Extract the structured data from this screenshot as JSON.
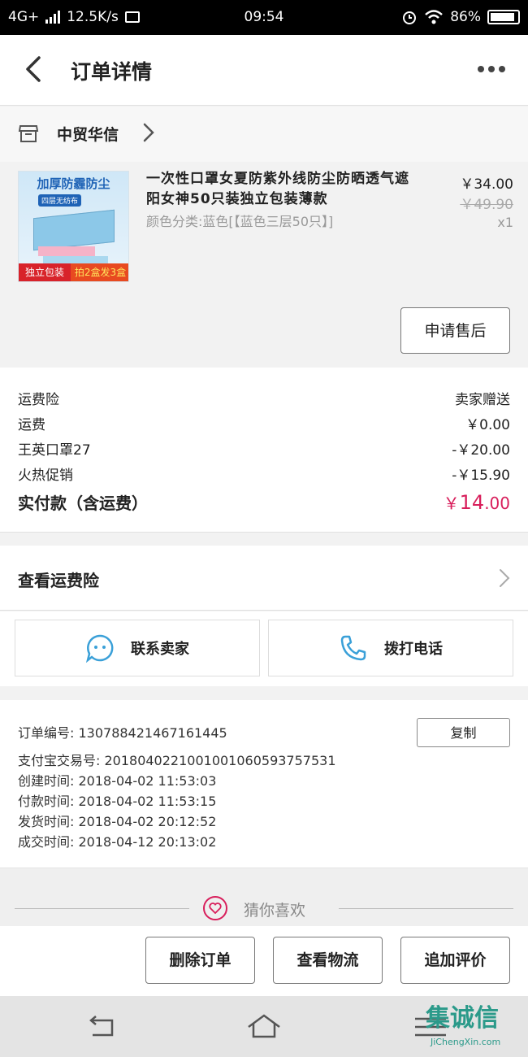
{
  "status_bar": {
    "network": "4G+",
    "speed": "12.5K/s",
    "time": "09:54",
    "battery": "86%"
  },
  "header": {
    "title": "订单详情"
  },
  "shop": {
    "name": "中贸华信"
  },
  "product": {
    "image_banner": "加厚防霾防尘",
    "image_sub": "四层无纺布",
    "image_tag_left": "独立包装",
    "image_tag_right": "拍2盒发3盒",
    "title": "一次性口罩女夏防紫外线防尘防晒透气遮阳女神50只装独立包装薄款",
    "spec": "颜色分类:蓝色[【蓝色三层50只】]",
    "price": "￥34.00",
    "original_price": "￥49.90",
    "quantity": "x1",
    "after_sale_label": "申请售后"
  },
  "fees": [
    {
      "label": "运费险",
      "value": "卖家赠送"
    },
    {
      "label": "运费",
      "value": "￥0.00"
    },
    {
      "label": "王英口罩27",
      "value": "-￥20.00"
    },
    {
      "label": "火热促销",
      "value": "-￥15.90"
    }
  ],
  "total": {
    "label": "实付款（含运费）",
    "currency": "￥",
    "integer": "14",
    "decimal": ".00"
  },
  "insurance": {
    "label": "查看运费险"
  },
  "contact": {
    "seller_label": "联系卖家",
    "phone_label": "拨打电话"
  },
  "order_info": {
    "copy_label": "复制",
    "rows": [
      "订单编号: 130788421467161445",
      "支付宝交易号: 2018040221001001060593757531",
      "创建时间: 2018-04-02 11:53:03",
      "付款时间: 2018-04-02 11:53:15",
      "发货时间: 2018-04-02 20:12:52",
      "成交时间: 2018-04-12 20:13:02"
    ]
  },
  "recommend": {
    "label": "猜你喜欢"
  },
  "actions": {
    "delete": "删除订单",
    "logistics": "查看物流",
    "review": "追加评价"
  },
  "watermark": {
    "cn": "集诚信",
    "en": "JiChengXin.com"
  },
  "colors": {
    "accent": "#d81e5b",
    "contact_icon": "#3aa0d8",
    "watermark": "#2b9a8a"
  }
}
